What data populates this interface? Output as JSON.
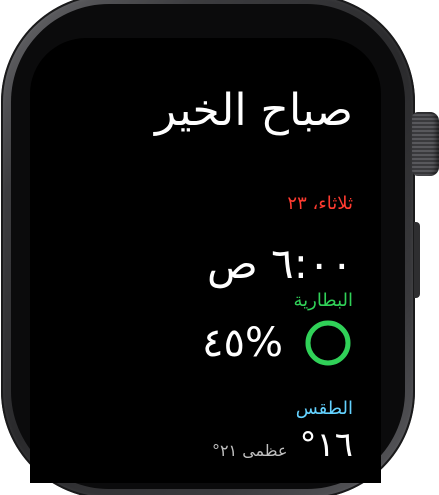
{
  "greeting": "صباح الخير",
  "date": "ثلاثاء، ٢٣",
  "time": "٦:٠٠ ص",
  "battery": {
    "label": "البطارية",
    "value": "%٤٥",
    "level": 0.45,
    "ring_color": "#30d158",
    "track_color": "#1f3d28"
  },
  "weather": {
    "label": "الطقس",
    "temperature": "١٦°",
    "detail": "عظمى ٢١°"
  },
  "colors": {
    "date": "#ff3b30",
    "battery_label": "#30d158",
    "weather_label": "#64d2ff",
    "screen_background": "#000000"
  }
}
